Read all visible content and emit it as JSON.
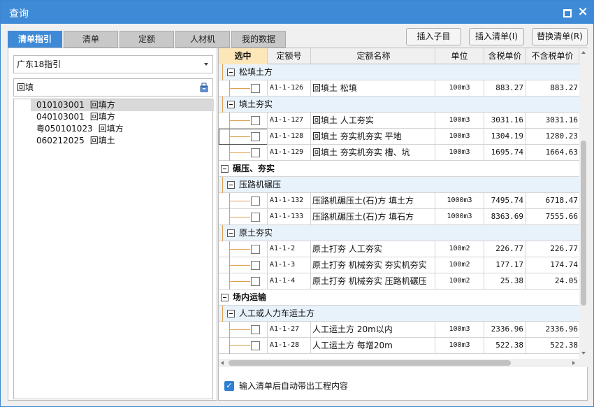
{
  "window": {
    "title": "查询"
  },
  "tabs": [
    {
      "label": "清单指引",
      "active": true
    },
    {
      "label": "清单",
      "active": false
    },
    {
      "label": "定额",
      "active": false
    },
    {
      "label": "人材机",
      "active": false
    },
    {
      "label": "我的数据",
      "active": false
    }
  ],
  "toolbar": {
    "insert_child": "插入子目",
    "insert_list": "插入清单(I)",
    "replace_list": "替换清单(R)"
  },
  "left": {
    "guide_select": "广东18指引",
    "search_value": "回填",
    "results": [
      {
        "code": "010103001",
        "name": "回填方",
        "selected": true
      },
      {
        "code": "040103001",
        "name": "回填方",
        "selected": false
      },
      {
        "code": "粤050101023",
        "name": "回填方",
        "selected": false
      },
      {
        "code": "060212025",
        "name": "回填土",
        "selected": false
      }
    ]
  },
  "grid": {
    "headers": {
      "select": "选中",
      "code": "定额号",
      "name": "定额名称",
      "unit": "单位",
      "tax_price": "含税单价",
      "notax_price": "不含税单价"
    },
    "rows": [
      {
        "type": "g2",
        "label": "松填土方"
      },
      {
        "type": "item",
        "code": "A1-1-126",
        "name": "回填土 松填",
        "unit": "100m3",
        "tax": "883.27",
        "notax": "883.27"
      },
      {
        "type": "g2",
        "label": "填土夯实"
      },
      {
        "type": "item",
        "code": "A1-1-127",
        "name": "回填土 人工夯实",
        "unit": "100m3",
        "tax": "3031.16",
        "notax": "3031.16"
      },
      {
        "type": "item",
        "code": "A1-1-128",
        "name": "回填土 夯实机夯实 平地",
        "unit": "100m3",
        "tax": "1304.19",
        "notax": "1280.23",
        "focus": true
      },
      {
        "type": "item",
        "code": "A1-1-129",
        "name": "回填土 夯实机夯实 槽、坑",
        "unit": "100m3",
        "tax": "1695.74",
        "notax": "1664.63"
      },
      {
        "type": "g1",
        "label": "碾压、夯实"
      },
      {
        "type": "g2",
        "label": "压路机碾压"
      },
      {
        "type": "item",
        "code": "A1-1-132",
        "name": "压路机碾压土(石)方 填土方",
        "unit": "1000m3",
        "tax": "7495.74",
        "notax": "6718.47"
      },
      {
        "type": "item",
        "code": "A1-1-133",
        "name": "压路机碾压土(石)方 填石方",
        "unit": "1000m3",
        "tax": "8363.69",
        "notax": "7555.66"
      },
      {
        "type": "g2",
        "label": "原土夯实"
      },
      {
        "type": "item",
        "code": "A1-1-2",
        "name": "原土打夯 人工夯实",
        "unit": "100m2",
        "tax": "226.77",
        "notax": "226.77"
      },
      {
        "type": "item",
        "code": "A1-1-3",
        "name": "原土打夯 机械夯实 夯实机夯实",
        "unit": "100m2",
        "tax": "177.17",
        "notax": "174.74"
      },
      {
        "type": "item",
        "code": "A1-1-4",
        "name": "原土打夯 机械夯实 压路机碾压",
        "unit": "100m2",
        "tax": "25.38",
        "notax": "24.05"
      },
      {
        "type": "g1",
        "label": "场内运输"
      },
      {
        "type": "g2",
        "label": "人工或人力车运土方"
      },
      {
        "type": "item",
        "code": "A1-1-27",
        "name": "人工运土方 20m以内",
        "unit": "100m3",
        "tax": "2336.96",
        "notax": "2336.96"
      },
      {
        "type": "item",
        "code": "A1-1-28",
        "name": "人工运土方 每增20m",
        "unit": "100m3",
        "tax": "522.38",
        "notax": "522.38"
      }
    ]
  },
  "option": {
    "label": "输入清单后自动带出工程内容",
    "checked": true
  }
}
